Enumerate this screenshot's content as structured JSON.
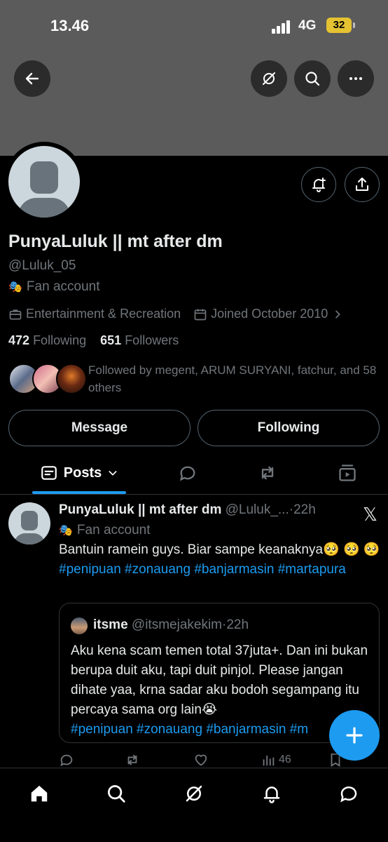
{
  "status_bar": {
    "time": "13.46",
    "network": "4G",
    "battery": "32"
  },
  "profile": {
    "name": "PunyaLuluk || mt after dm",
    "handle": "@Luluk_05",
    "category": "Fan account",
    "professional_category": "Entertainment & Recreation",
    "joined": "Joined October 2010",
    "following_count": "472",
    "following_label": "Following",
    "followers_count": "651",
    "followers_label": "Followers",
    "followed_by": "Followed by megent, ARUM SURYANI, fatchur, and 58 others"
  },
  "buttons": {
    "message": "Message",
    "following": "Following"
  },
  "tabs": {
    "posts": "Posts"
  },
  "tweet": {
    "name": "PunyaLuluk || mt after dm",
    "meta": "@Luluk_...·22h",
    "category": "Fan account",
    "text": "Bantuin ramein guys. Biar sampe keanaknya🥺 🥺 🥺 ",
    "hashtags": "#penipuan #zonauang #banjarmasin #martapura",
    "views": "46",
    "quote": {
      "name": "itsme",
      "meta": "@itsmejakekim·22h",
      "text": "Aku kena scam temen total 37juta+. Dan ini bukan berupa duit aku, tapi duit pinjol. Please jangan dihate yaa, krna sadar aku bodoh segampang itu percaya sama org lain😭",
      "hashtags": "#penipuan #zonauang #banjarmasin #m"
    }
  },
  "colors": {
    "accent": "#1d9bf0",
    "banner": "#5b5b5b",
    "battery": "#e4c232"
  },
  "icons": {
    "back": "arrow-left-icon",
    "grok": "grok-icon",
    "search": "search-icon",
    "more": "more-icon",
    "notify": "bell-plus-icon",
    "share": "share-icon",
    "x_logo": "x-logo-icon"
  }
}
